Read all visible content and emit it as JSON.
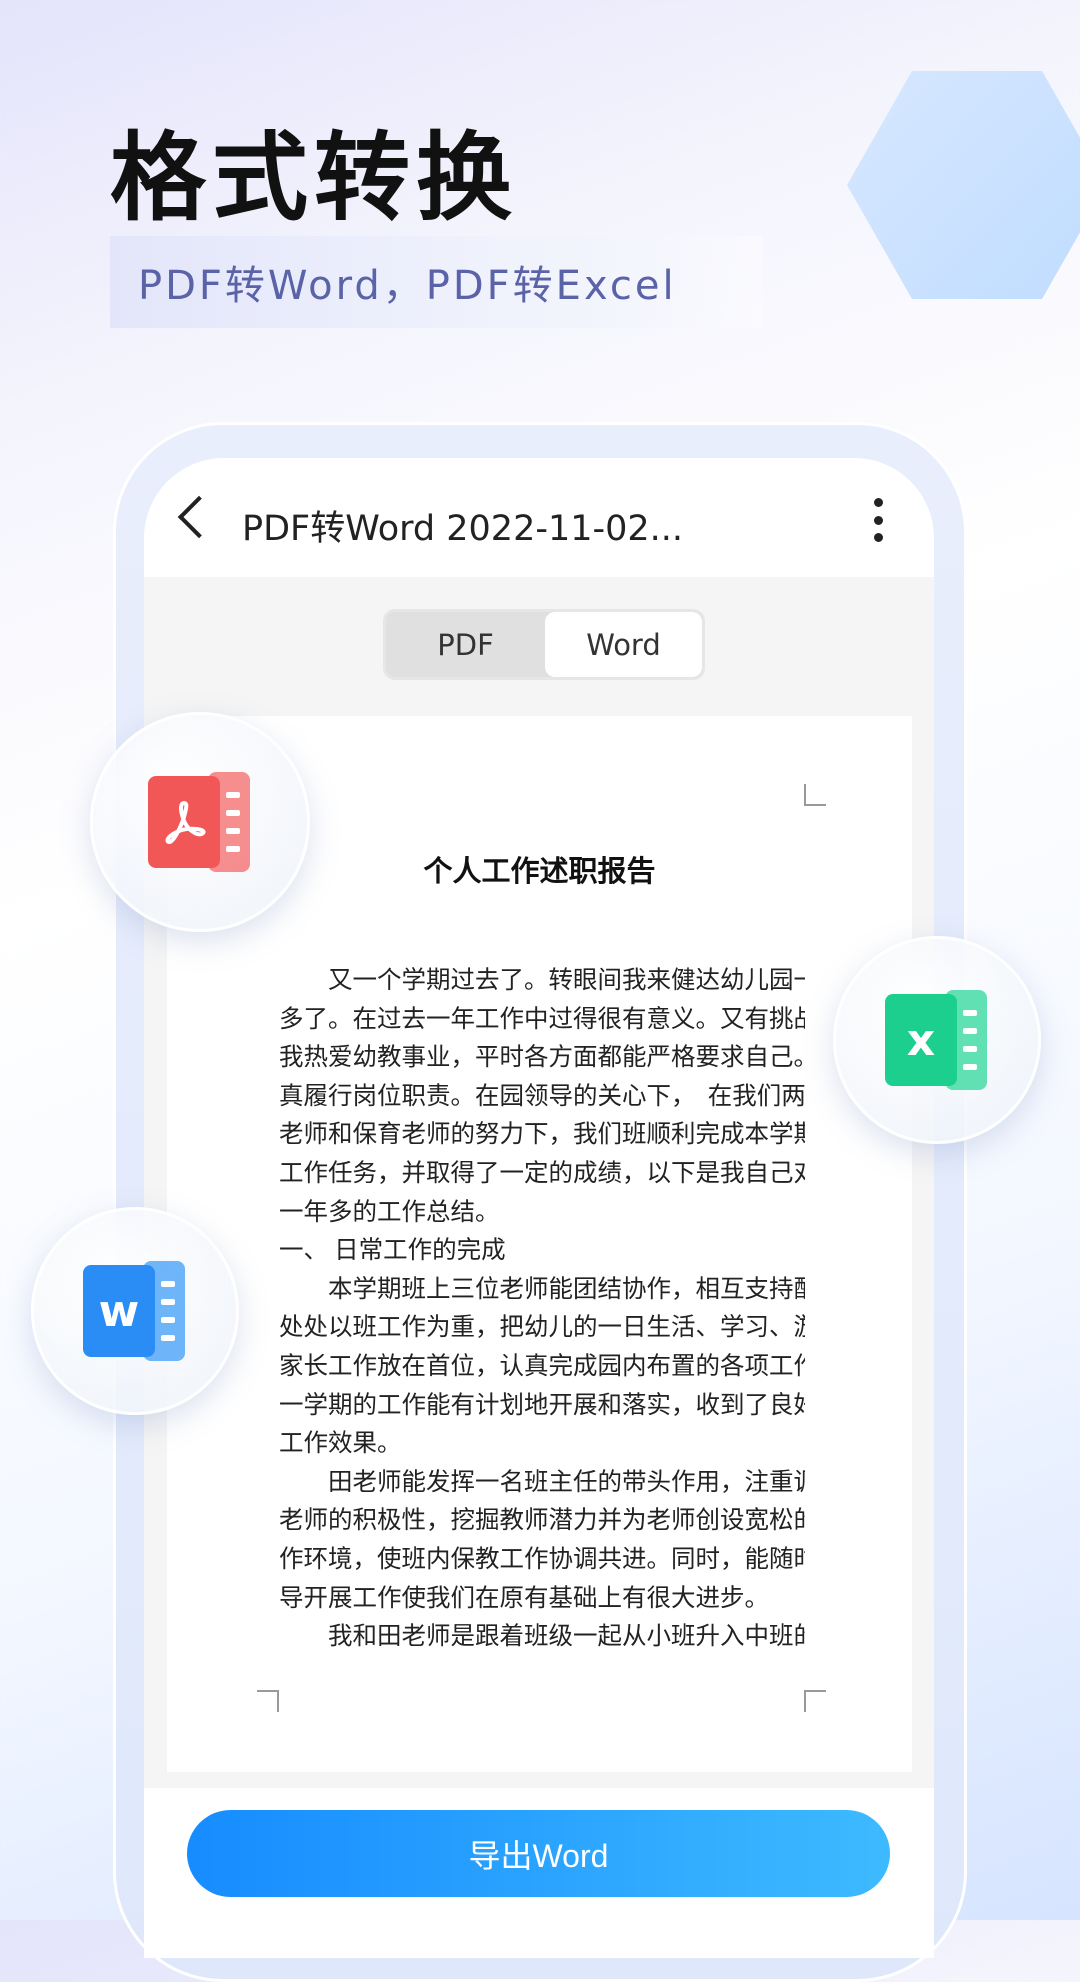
{
  "hero": {
    "title": "格式转换",
    "subtitle": "PDF转Word，PDF转Excel"
  },
  "app": {
    "header": {
      "title": "PDF转Word 2022-11-02...",
      "back_icon": "chevron-left-icon",
      "menu_icon": "more-vertical-icon"
    },
    "tabs": [
      {
        "label": "PDF",
        "selected": false
      },
      {
        "label": "Word",
        "selected": true
      }
    ],
    "document": {
      "title": "个人工作述职报告",
      "lines": [
        "　　又一个学期过去了。转眼间我来健达幼儿园一年",
        "多了。在过去一年工作中过得很有意义。又有挑战性。",
        "我热爱幼教事业，平时各方面都能严格要求自己。认",
        "真履行岗位职责。在园领导的关心下，　在我们两位",
        "老师和保育老师的努力下，我们班顺利完成本学期的",
        "工作任务，并取得了一定的成绩，以下是我自己对这",
        "一年多的工作总结。",
        "一、 日常工作的完成",
        "　　本学期班上三位老师能团结协作，相互支持配合，",
        "处处以班工作为重，把幼儿的一日生活、学习、游戏、",
        "家长工作放在首位，认真完成园内布置的各项工作，",
        "一学期的工作能有计划地开展和落实，收到了良好的",
        "工作效果。",
        "　　田老师能发挥一名班主任的带头作用，注重调动",
        "老师的积极性，挖掘教师潜力并为老师创设宽松的工",
        "作环境，使班内保教工作协调共进。同时，能随时指",
        "导开展工作使我们在原有基础上有很大进步。",
        "　　我和田老师是跟着班级一起从小班升入中班的老"
      ]
    },
    "export_label": "导出Word"
  },
  "icons": {
    "pdf": {
      "name": "pdf-file-icon",
      "color": "#f25757"
    },
    "excel": {
      "name": "excel-file-icon",
      "color": "#1ccf8f",
      "letter": "x"
    },
    "word": {
      "name": "word-file-icon",
      "color": "#2a8cf5",
      "letter": "w"
    }
  },
  "colors": {
    "accent_start": "#168cff",
    "accent_end": "#3dbaff",
    "subtitle": "#5a62a8"
  }
}
